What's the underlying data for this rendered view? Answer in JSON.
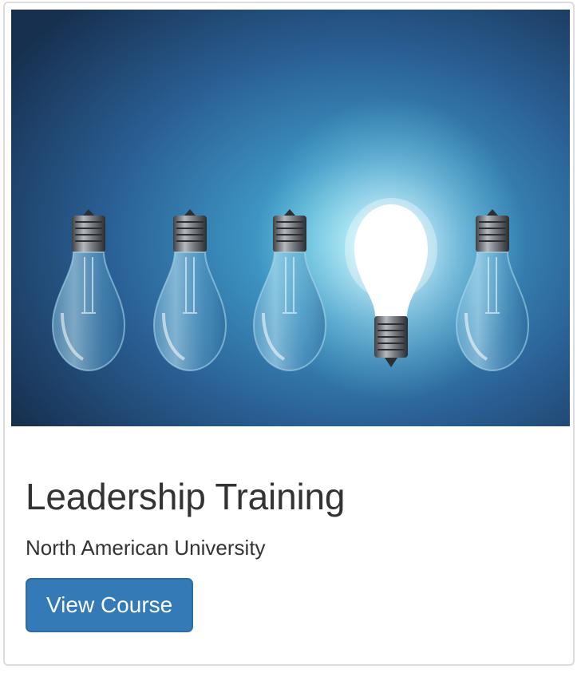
{
  "course_card": {
    "image_alt": "Row of light bulbs with one lit",
    "title": "Leadership Training",
    "institution": "North American University",
    "button_label": "View Course",
    "colors": {
      "button_bg": "#337ab7",
      "button_border": "#2e6da4",
      "text": "#333333",
      "image_bg": "#2f6aa0"
    },
    "bulbs": [
      {
        "lit": false
      },
      {
        "lit": false
      },
      {
        "lit": false
      },
      {
        "lit": true
      },
      {
        "lit": false
      }
    ]
  }
}
